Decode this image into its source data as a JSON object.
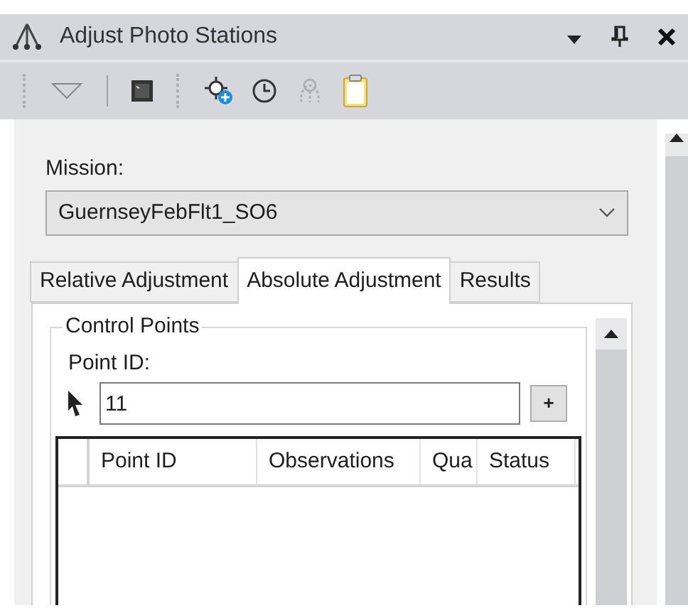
{
  "window": {
    "title": "Adjust Photo Stations"
  },
  "toolbar": [
    {
      "kind": "dropdown",
      "disabled": false
    },
    {
      "kind": "terminal",
      "disabled": false
    },
    {
      "kind": "add-point",
      "disabled": false
    },
    {
      "kind": "clock",
      "disabled": false
    },
    {
      "kind": "network",
      "disabled": true
    },
    {
      "kind": "clipboard",
      "disabled": false
    }
  ],
  "mission": {
    "label": "Mission:",
    "value": "GuernseyFebFlt1_SO6"
  },
  "tabs": [
    {
      "label": "Relative Adjustment",
      "selected": false
    },
    {
      "label": "Absolute Adjustment",
      "selected": true
    },
    {
      "label": "Results",
      "selected": false
    }
  ],
  "control_points": {
    "title": "Control Points",
    "point_id_label": "Point ID:",
    "point_id_value": "11",
    "add_button": "+"
  },
  "table": {
    "columns": [
      "Point ID",
      "Observations",
      "Qua",
      "Status"
    ]
  }
}
